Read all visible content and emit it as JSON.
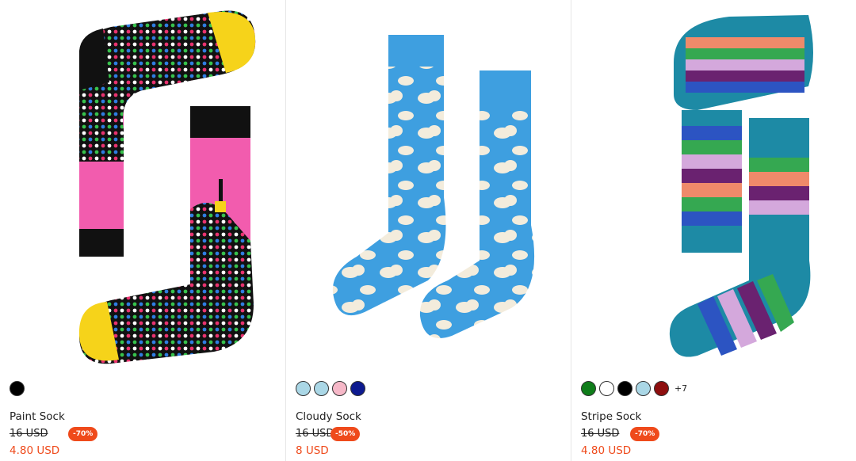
{
  "products": [
    {
      "name": "Paint Sock",
      "old_price": "16 USD",
      "discount": "-70%",
      "price": "4.80 USD",
      "swatches": [
        "#000000"
      ],
      "more_colors": ""
    },
    {
      "name": "Cloudy Sock",
      "old_price": "16 USD",
      "discount": "-50%",
      "price": "8 USD",
      "swatches": [
        "#aad7e6",
        "#aad7e6",
        "#f6b8c8",
        "#0d1a8f"
      ],
      "more_colors": ""
    },
    {
      "name": "Stripe Sock",
      "old_price": "16 USD",
      "discount": "-70%",
      "price": "4.80 USD",
      "swatches": [
        "#0f7d1a",
        "#ffffff",
        "#000000",
        "#aad7e6",
        "#8e0e0e"
      ],
      "more_colors": "+7"
    }
  ],
  "accent_color": "#ef4a1b"
}
